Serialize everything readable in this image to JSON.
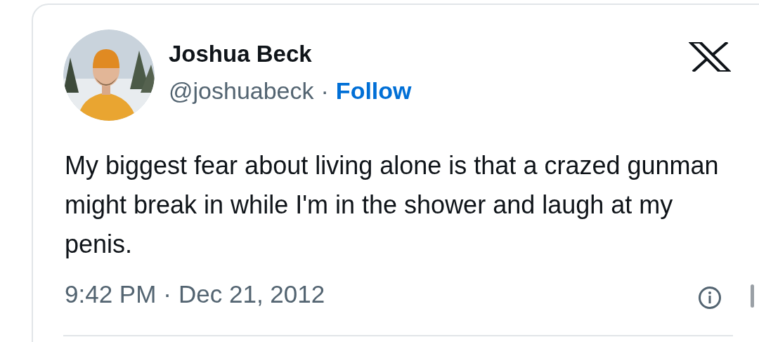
{
  "author": {
    "name": "Joshua Beck",
    "handle": "@joshuabeck",
    "separator": "·",
    "follow": "Follow"
  },
  "tweet": {
    "text": "My biggest fear about living alone is that a crazed gunman might break in while I'm in the shower and laugh at my penis.",
    "time": "9:42 PM",
    "date_separator": "·",
    "date": "Dec 21, 2012"
  }
}
